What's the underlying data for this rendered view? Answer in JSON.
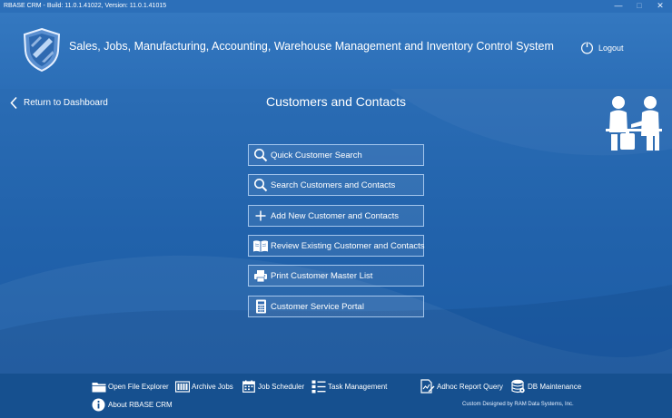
{
  "window": {
    "title": "RBASE CRM - Build: 11.0.1.41022, Version: 11.0.1.41015",
    "minimize": "—",
    "maximize": "□",
    "close": "✕"
  },
  "header": {
    "title": "Sales, Jobs, Manufacturing, Accounting, Warehouse Management and Inventory Control System",
    "logout_label": "Logout",
    "logo_icon": "shield-logo-icon"
  },
  "nav": {
    "back_label": "Return to Dashboard"
  },
  "page": {
    "title": "Customers and Contacts",
    "illustration_icon": "people-meeting-icon"
  },
  "menu": [
    {
      "label": "Quick Customer Search",
      "icon": "search-icon"
    },
    {
      "label": "Search Customers and Contacts",
      "icon": "search-icon"
    },
    {
      "label": "Add New Customer and Contacts",
      "icon": "plus-icon"
    },
    {
      "label": "Review Existing Customer and Contacts",
      "icon": "book-icon"
    },
    {
      "label": "Print Customer Master List",
      "icon": "printer-icon"
    },
    {
      "label": "Customer Service Portal",
      "icon": "calculator-icon"
    }
  ],
  "footer": {
    "items": [
      {
        "label": "Open File Explorer",
        "icon": "folder-icon"
      },
      {
        "label": "Archive Jobs",
        "icon": "archive-icon"
      },
      {
        "label": "Job Scheduler",
        "icon": "calendar-icon"
      },
      {
        "label": "Task Management",
        "icon": "task-list-icon"
      },
      {
        "label": "Adhoc Report Query",
        "icon": "report-edit-icon"
      },
      {
        "label": "DB Maintenance",
        "icon": "database-icon"
      },
      {
        "label": "About RBASE CRM",
        "icon": "info-icon"
      }
    ],
    "credit": "Custom Designed by RAM Data Systems, Inc."
  },
  "colors": {
    "background": "#2162ab",
    "header": "#3478c0",
    "footer": "#16508f",
    "text": "#ffffff"
  }
}
